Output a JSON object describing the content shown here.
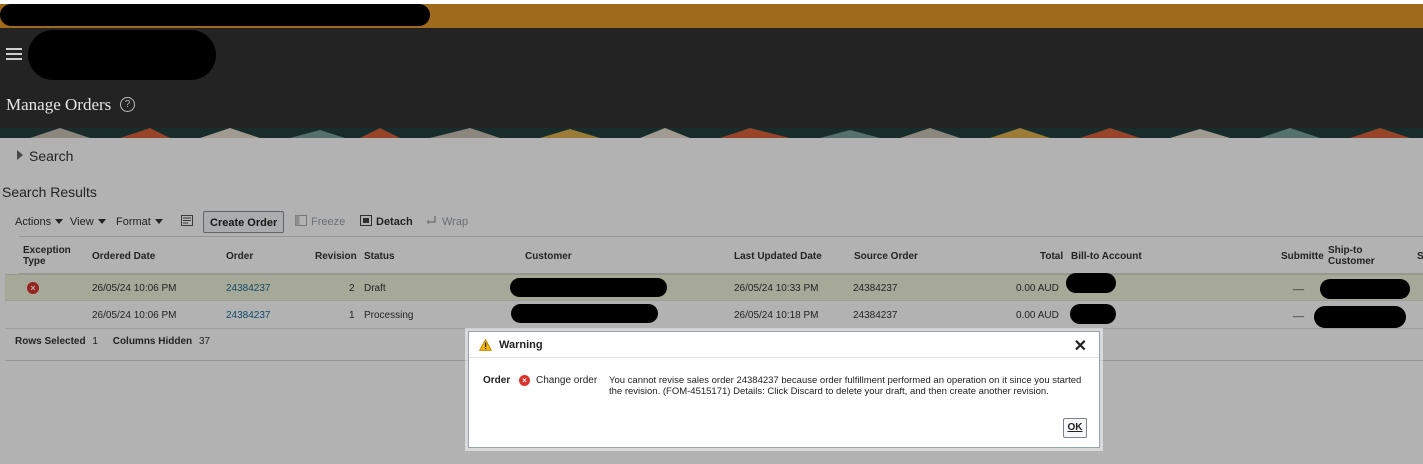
{
  "header": {
    "page_title": "Manage Orders",
    "help_glyph": "?"
  },
  "search": {
    "label": "Search"
  },
  "results": {
    "title": "Search Results",
    "toolbar": {
      "actions": "Actions",
      "view": "View",
      "format": "Format",
      "create_order": "Create Order",
      "freeze": "Freeze",
      "detach": "Detach",
      "wrap": "Wrap"
    },
    "columns": {
      "exception_type": "Exception Type",
      "ordered_date": "Ordered Date",
      "order": "Order",
      "revision": "Revision",
      "status": "Status",
      "customer": "Customer",
      "last_updated": "Last Updated Date",
      "source_order": "Source Order",
      "total": "Total",
      "bill_to": "Bill-to Account",
      "submitted": "Submitte",
      "ship_to": "Ship-to Customer",
      "more": "S"
    },
    "rows": [
      {
        "ordered_date": "26/05/24 10:06 PM",
        "order": "24384237",
        "revision": "2",
        "status": "Draft",
        "last_updated": "26/05/24 10:33 PM",
        "source_order": "24384237",
        "total": "0.00 AUD",
        "submitted": "__",
        "exception": true
      },
      {
        "ordered_date": "26/05/24 10:06 PM",
        "order": "24384237",
        "revision": "1",
        "status": "Processing",
        "last_updated": "26/05/24 10:18 PM",
        "source_order": "24384237",
        "total": "0.00 AUD",
        "submitted": "__",
        "exception": false
      }
    ],
    "footer": {
      "rows_selected_label": "Rows Selected",
      "rows_selected_value": "1",
      "columns_hidden_label": "Columns Hidden",
      "columns_hidden_value": "37"
    }
  },
  "dialog": {
    "title": "Warning",
    "close_glyph": "✕",
    "label": "Order",
    "sub_label": "Change order",
    "message": "You cannot revise sales order 24384237 because order fulfillment performed an operation on it since you started the revision. (FOM-4515171) Details: Click Discard to delete your draft, and then create another revision.",
    "ok": "OK"
  },
  "colors": {
    "brand_gold": "#a06a1c",
    "header_dark": "#232323",
    "link": "#1a6a9a",
    "error_red": "#d9332b",
    "warning_yellow": "#f2b600",
    "selected_row": "#eef2d8"
  },
  "icons": [
    "hamburger-icon",
    "help-icon",
    "expand-triangle-icon",
    "export-icon",
    "freeze-icon",
    "detach-icon",
    "wrap-icon",
    "error-icon",
    "warning-icon",
    "close-icon"
  ]
}
